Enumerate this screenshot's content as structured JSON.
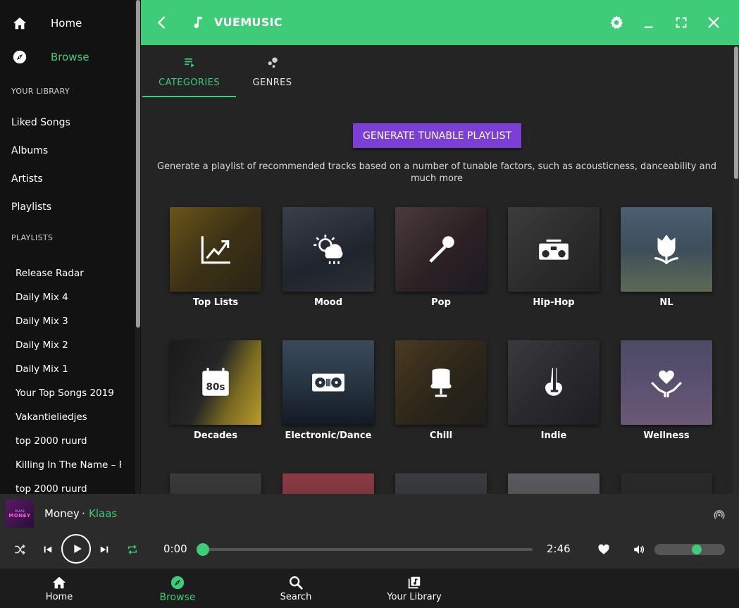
{
  "sidebar": {
    "nav": [
      {
        "label": "Home",
        "icon": "home-icon"
      },
      {
        "label": "Browse",
        "icon": "compass-icon",
        "active": true
      }
    ],
    "library_heading": "YOUR LIBRARY",
    "library": [
      "Liked Songs",
      "Albums",
      "Artists",
      "Playlists"
    ],
    "playlists_heading": "PLAYLISTS",
    "playlists": [
      "Release Radar",
      "Daily Mix 4",
      "Daily Mix 3",
      "Daily Mix 2",
      "Daily Mix 1",
      "Your Top Songs 2019",
      "Vakantieliedjes",
      "top 2000 ruurd",
      "Killing In The Name – R",
      "top 2000 ruurd"
    ]
  },
  "topbar": {
    "title": "VUEMUSIC",
    "color": "#3ecc78"
  },
  "tabs": [
    {
      "label": "CATEGORIES",
      "icon": "playlist-icon",
      "active": true
    },
    {
      "label": "GENRES",
      "icon": "bubbles-icon"
    }
  ],
  "generate": {
    "button_label": "GENERATE TUNABLE PLAYLIST",
    "description": "Generate a playlist of recommended tracks based on a number of tunable factors, such as acousticness, danceability and much more",
    "color": "#7b3fd6"
  },
  "categories": [
    {
      "label": "Top Lists",
      "icon": "chart-icon"
    },
    {
      "label": "Mood",
      "icon": "weather-icon"
    },
    {
      "label": "Pop",
      "icon": "microphone-icon"
    },
    {
      "label": "Hip-Hop",
      "icon": "boombox-icon"
    },
    {
      "label": "NL",
      "icon": "tulip-icon"
    },
    {
      "label": "Decades",
      "icon": "calendar-80s-icon"
    },
    {
      "label": "Electronic/Dance",
      "icon": "dj-deck-icon"
    },
    {
      "label": "Chill",
      "icon": "egg-chair-icon"
    },
    {
      "label": "Indie",
      "icon": "guitar-icon"
    },
    {
      "label": "Wellness",
      "icon": "heart-hands-icon"
    }
  ],
  "player": {
    "track": "Money",
    "separator": "·",
    "artist": "Klaas",
    "album_art_text_1": "KLAAS",
    "album_art_text_2": "MONEY",
    "current_time": "0:00",
    "total_time": "2:46",
    "progress": 0,
    "volume": 0.62
  },
  "bottom_nav": [
    {
      "label": "Home",
      "icon": "home-icon"
    },
    {
      "label": "Browse",
      "icon": "compass-icon",
      "active": true
    },
    {
      "label": "Search",
      "icon": "search-icon"
    },
    {
      "label": "Your Library",
      "icon": "library-icon"
    }
  ]
}
